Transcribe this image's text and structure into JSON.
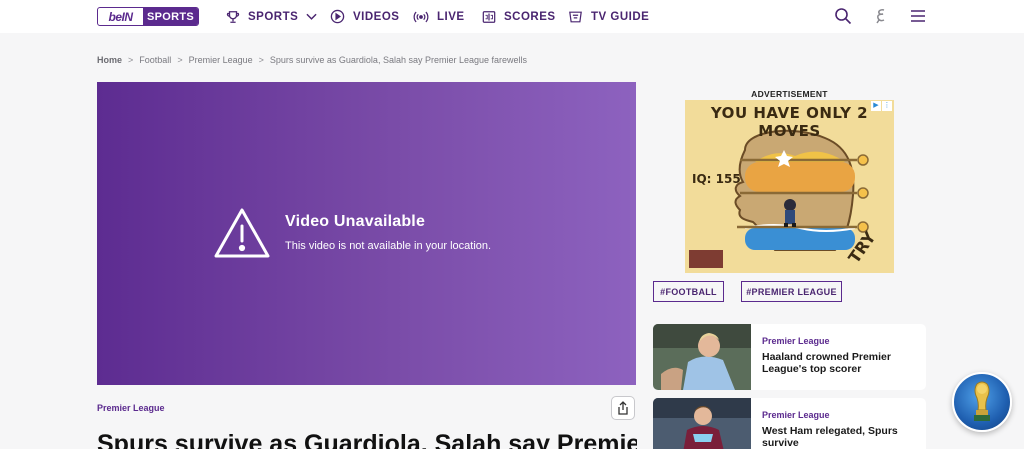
{
  "header": {
    "logo_part1": "beIN",
    "logo_part2": "SPORTS",
    "nav": [
      {
        "label": "SPORTS",
        "icon": "trophy-icon"
      },
      {
        "label": "VIDEOS",
        "icon": "play-circle-icon"
      },
      {
        "label": "LIVE",
        "icon": "broadcast-icon"
      },
      {
        "label": "SCORES",
        "icon": "scoreboard-icon"
      },
      {
        "label": "TV GUIDE",
        "icon": "tv-icon"
      }
    ],
    "icons": [
      "search-icon",
      "language-icon",
      "menu-icon"
    ]
  },
  "breadcrumb": {
    "items": [
      "Home",
      "Football",
      "Premier League",
      "Spurs survive as Guardiola, Salah say Premier League farewells"
    ],
    "separator": ">"
  },
  "video": {
    "title": "Video Unavailable",
    "message": "This video is not available in your location.",
    "icon": "warning-icon"
  },
  "article": {
    "category": "Premier League",
    "headline": "Spurs survive as Guardiola, Salah say Premier League farewells"
  },
  "ad": {
    "label": "ADVERTISEMENT",
    "headline": "YOU HAVE ONLY 2 MOVES",
    "iq": "IQ: 155",
    "cta": "TRY"
  },
  "tags": [
    "#FOOTBALL",
    "#PREMIER LEAGUE"
  ],
  "related": [
    {
      "category": "Premier League",
      "title": "Haaland crowned Premier League's top scorer"
    },
    {
      "category": "Premier League",
      "title": "West Ham relegated, Spurs survive"
    }
  ],
  "colors": {
    "brand": "#5b2a8e",
    "video_gradient_start": "#5d2c91",
    "video_gradient_end": "#8d62bf"
  }
}
